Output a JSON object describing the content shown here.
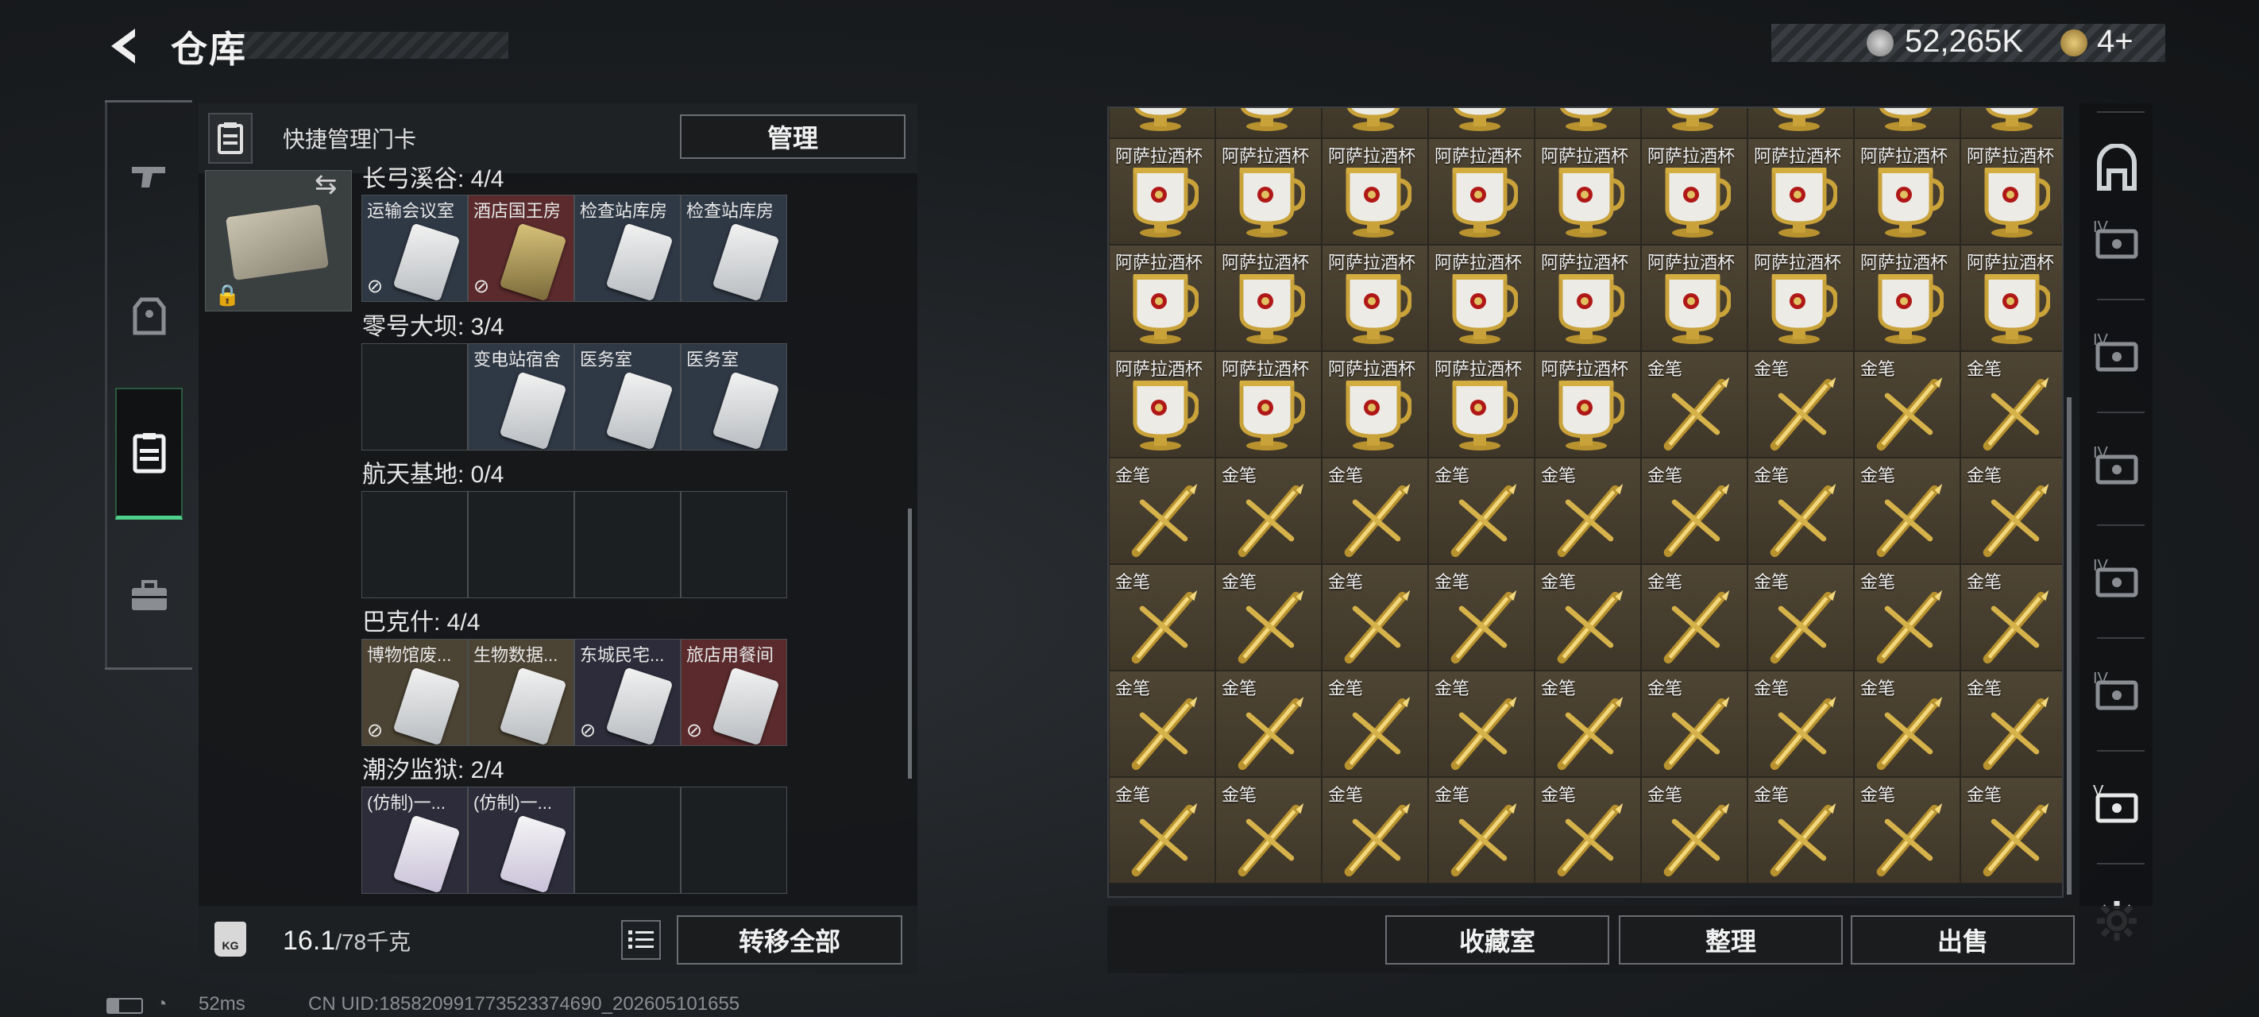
{
  "header": {
    "title": "仓库"
  },
  "currency": {
    "coins": "52,265K",
    "tickets": "4+"
  },
  "nav": [
    "weapons-icon",
    "armor-icon",
    "keycard-icon",
    "case-icon"
  ],
  "keycard_panel": {
    "quick_manage_label": "快捷管理门卡",
    "manage_button": "管理",
    "maps": [
      {
        "label": "长弓溪谷: 4/4",
        "slots": [
          {
            "name": "运输会议室",
            "tone": "blue",
            "card": "white",
            "noswap": true
          },
          {
            "name": "酒店国王房",
            "tone": "red",
            "card": "gold",
            "noswap": true
          },
          {
            "name": "检查站库房",
            "tone": "blue",
            "card": "white",
            "noswap": false
          },
          {
            "name": "检查站库房",
            "tone": "blue",
            "card": "white",
            "noswap": false
          }
        ]
      },
      {
        "label": "零号大坝: 3/4",
        "slots": [
          {
            "name": "",
            "tone": "empty",
            "card": "",
            "noswap": false
          },
          {
            "name": "变电站宿舍",
            "tone": "blue",
            "card": "white",
            "noswap": false
          },
          {
            "name": "医务室",
            "tone": "blue",
            "card": "white",
            "noswap": false
          },
          {
            "name": "医务室",
            "tone": "blue",
            "card": "white",
            "noswap": false
          }
        ]
      },
      {
        "label": "航天基地: 0/4",
        "slots": [
          {
            "name": "",
            "tone": "empty",
            "card": "",
            "noswap": false
          },
          {
            "name": "",
            "tone": "empty",
            "card": "",
            "noswap": false
          },
          {
            "name": "",
            "tone": "empty",
            "card": "",
            "noswap": false
          },
          {
            "name": "",
            "tone": "empty",
            "card": "",
            "noswap": false
          }
        ]
      },
      {
        "label": "巴克什: 4/4",
        "slots": [
          {
            "name": "博物馆废...",
            "tone": "gold",
            "card": "white",
            "noswap": true
          },
          {
            "name": "生物数据...",
            "tone": "gold",
            "card": "white",
            "noswap": false
          },
          {
            "name": "东城民宅...",
            "tone": "purple",
            "card": "white",
            "noswap": true
          },
          {
            "name": "旅店用餐间",
            "tone": "red",
            "card": "white",
            "noswap": true
          }
        ]
      },
      {
        "label": "潮汐监狱: 2/4",
        "slots": [
          {
            "name": "(仿制)一...",
            "tone": "purple",
            "card": "purple",
            "noswap": false
          },
          {
            "name": "(仿制)一...",
            "tone": "purple",
            "card": "purple",
            "noswap": false
          },
          {
            "name": "",
            "tone": "empty",
            "card": "",
            "noswap": false
          },
          {
            "name": "",
            "tone": "empty",
            "card": "",
            "noswap": false
          }
        ]
      }
    ],
    "weight_value": "16.1",
    "weight_max": "/78千克",
    "weight_icon_text": "KG",
    "transfer_all_button": "转移全部"
  },
  "inventory": {
    "cup_label": "阿萨拉酒杯",
    "pen_label": "金笔",
    "rows": [
      [
        "cup",
        "cup",
        "cup",
        "cup",
        "cup",
        "cup",
        "cup",
        "cup",
        "cup"
      ],
      [
        "cup",
        "cup",
        "cup",
        "cup",
        "cup",
        "cup",
        "cup",
        "cup",
        "cup"
      ],
      [
        "cup",
        "cup",
        "cup",
        "cup",
        "cup",
        "cup",
        "cup",
        "cup",
        "cup"
      ],
      [
        "cup",
        "cup",
        "cup",
        "cup",
        "cup",
        "pen",
        "pen",
        "pen",
        "pen"
      ],
      [
        "pen",
        "pen",
        "pen",
        "pen",
        "pen",
        "pen",
        "pen",
        "pen",
        "pen"
      ],
      [
        "pen",
        "pen",
        "pen",
        "pen",
        "pen",
        "pen",
        "pen",
        "pen",
        "pen"
      ],
      [
        "pen",
        "pen",
        "pen",
        "pen",
        "pen",
        "pen",
        "pen",
        "pen",
        "pen"
      ],
      [
        "pen",
        "pen",
        "pen",
        "pen",
        "pen",
        "pen",
        "pen",
        "pen",
        "pen"
      ]
    ]
  },
  "actions": {
    "collection": "收藏室",
    "organize": "整理",
    "sell": "出售"
  },
  "rail": {
    "tier_label": "IV",
    "tier_label_v": "V",
    "items": [
      "home-icon",
      "case-iv-icon",
      "case-iv-icon",
      "case-iv-icon",
      "case-iv-icon",
      "case-iv-icon",
      "case-v-icon"
    ],
    "settings": "gear-icon"
  },
  "status": {
    "ping": "52ms",
    "uid": "CN UID:185820991773523374690_202605101655"
  },
  "colors": {
    "accent_green": "#4fd08a",
    "cell_gold": "#4e4534"
  }
}
